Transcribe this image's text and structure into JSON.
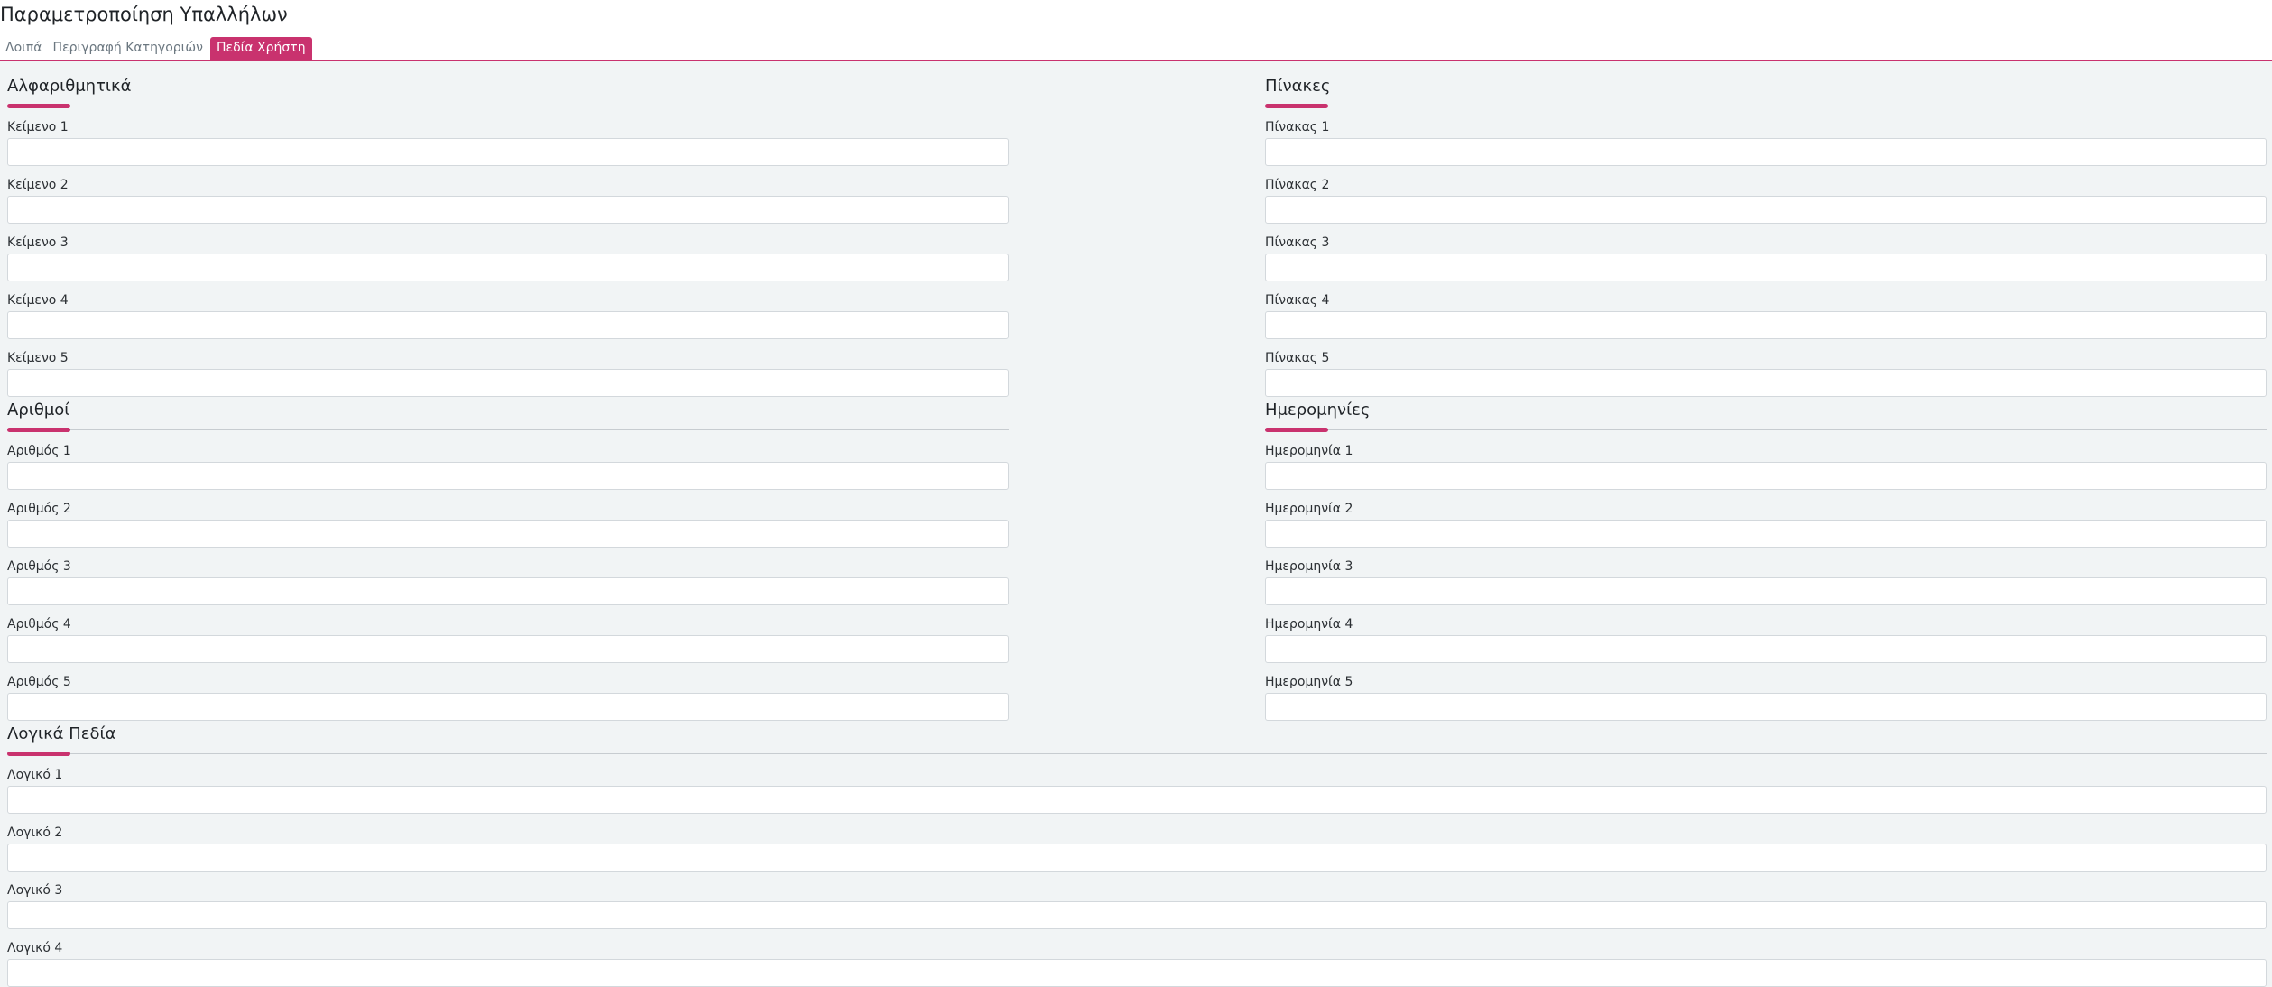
{
  "page_title": "Παραμετροποίηση Υπαλλήλων",
  "tabs": [
    {
      "label": "Λοιπά"
    },
    {
      "label": "Περιγραφή Κατηγοριών"
    },
    {
      "label": "Πεδία Χρήστη",
      "active": true
    }
  ],
  "accent_color": "#c9326e",
  "sections": {
    "alphanumeric": {
      "title": "Αλφαριθμητικά",
      "fields": [
        {
          "label": "Κείμενο 1",
          "value": ""
        },
        {
          "label": "Κείμενο 2",
          "value": ""
        },
        {
          "label": "Κείμενο 3",
          "value": ""
        },
        {
          "label": "Κείμενο 4",
          "value": ""
        },
        {
          "label": "Κείμενο 5",
          "value": ""
        }
      ]
    },
    "tables": {
      "title": "Πίνακες",
      "fields": [
        {
          "label": "Πίνακας 1",
          "value": ""
        },
        {
          "label": "Πίνακας 2",
          "value": ""
        },
        {
          "label": "Πίνακας 3",
          "value": ""
        },
        {
          "label": "Πίνακας 4",
          "value": ""
        },
        {
          "label": "Πίνακας 5",
          "value": ""
        }
      ]
    },
    "numbers": {
      "title": "Αριθμοί",
      "fields": [
        {
          "label": "Αριθμός 1",
          "value": ""
        },
        {
          "label": "Αριθμός 2",
          "value": ""
        },
        {
          "label": "Αριθμός 3",
          "value": ""
        },
        {
          "label": "Αριθμός 4",
          "value": ""
        },
        {
          "label": "Αριθμός 5",
          "value": ""
        }
      ]
    },
    "dates": {
      "title": "Ημερομηνίες",
      "fields": [
        {
          "label": "Ημερομηνία 1",
          "value": ""
        },
        {
          "label": "Ημερομηνία 2",
          "value": ""
        },
        {
          "label": "Ημερομηνία 3",
          "value": ""
        },
        {
          "label": "Ημερομηνία 4",
          "value": ""
        },
        {
          "label": "Ημερομηνία 5",
          "value": ""
        }
      ]
    },
    "logical": {
      "title": "Λογικά Πεδία",
      "fields": [
        {
          "label": "Λογικό 1",
          "value": ""
        },
        {
          "label": "Λογικό 2",
          "value": ""
        },
        {
          "label": "Λογικό 3",
          "value": ""
        },
        {
          "label": "Λογικό 4",
          "value": ""
        }
      ]
    }
  }
}
